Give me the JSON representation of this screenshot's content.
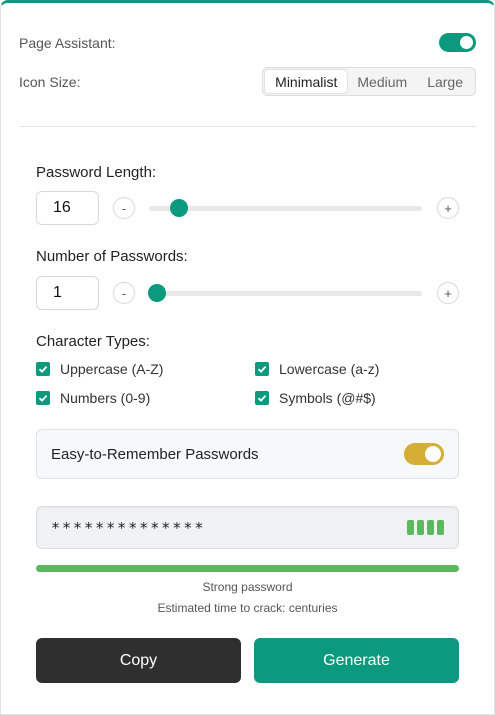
{
  "settings": {
    "page_assistant_label": "Page Assistant:",
    "page_assistant_on": true,
    "icon_size_label": "Icon Size:",
    "icon_size_options": [
      "Minimalist",
      "Medium",
      "Large"
    ],
    "icon_size_selected": "Minimalist"
  },
  "length": {
    "label": "Password Length:",
    "value": "16",
    "minus": "-",
    "plus": "+",
    "slider_fraction": 0.11
  },
  "count": {
    "label": "Number of Passwords:",
    "value": "1",
    "minus": "-",
    "plus": "+",
    "slider_fraction": 0.03
  },
  "char_types": {
    "label": "Character Types:",
    "uppercase": "Uppercase (A-Z)",
    "lowercase": "Lowercase (a-z)",
    "numbers": "Numbers (0-9)",
    "symbols": "Symbols (@#$)"
  },
  "easy": {
    "label": "Easy-to-Remember Passwords",
    "on": true
  },
  "password": {
    "masked": "**************",
    "strength_segments": 4
  },
  "strength": {
    "label": "Strong password",
    "crack_time": "Estimated time to crack: centuries"
  },
  "actions": {
    "copy": "Copy",
    "generate": "Generate"
  },
  "colors": {
    "accent": "#0b9a7d",
    "toggle_gold": "#d4ae35",
    "strength": "#5cb85c"
  }
}
